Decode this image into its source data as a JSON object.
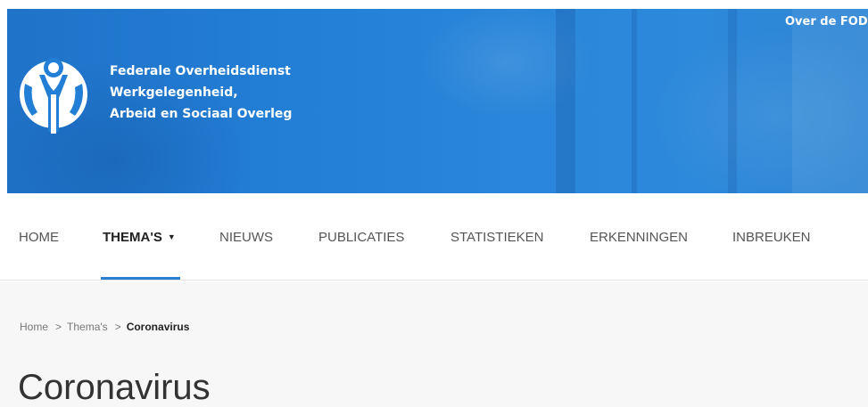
{
  "header": {
    "top_link": "Over de FOD",
    "org_name": {
      "line1": "Federale Overheidsdienst",
      "line2": "Werkgelegenheid,",
      "line3": "Arbeid en Sociaal Overleg"
    }
  },
  "nav": {
    "items": [
      {
        "label": "HOME"
      },
      {
        "label": "THEMA'S",
        "active": true,
        "has_dropdown": true
      },
      {
        "label": "NIEUWS"
      },
      {
        "label": "PUBLICATIES"
      },
      {
        "label": "STATISTIEKEN"
      },
      {
        "label": "ERKENNINGEN"
      },
      {
        "label": "INBREUKEN"
      }
    ]
  },
  "breadcrumb": {
    "items": [
      {
        "label": "Home"
      },
      {
        "label": "Thema's"
      },
      {
        "label": "Coronavirus",
        "current": true
      }
    ],
    "separator": ">"
  },
  "page": {
    "title": "Coronavirus"
  },
  "colors": {
    "banner_blue": "#237fd6",
    "nav_accent": "#2a7fd3",
    "content_bg": "#f7f7f7"
  }
}
